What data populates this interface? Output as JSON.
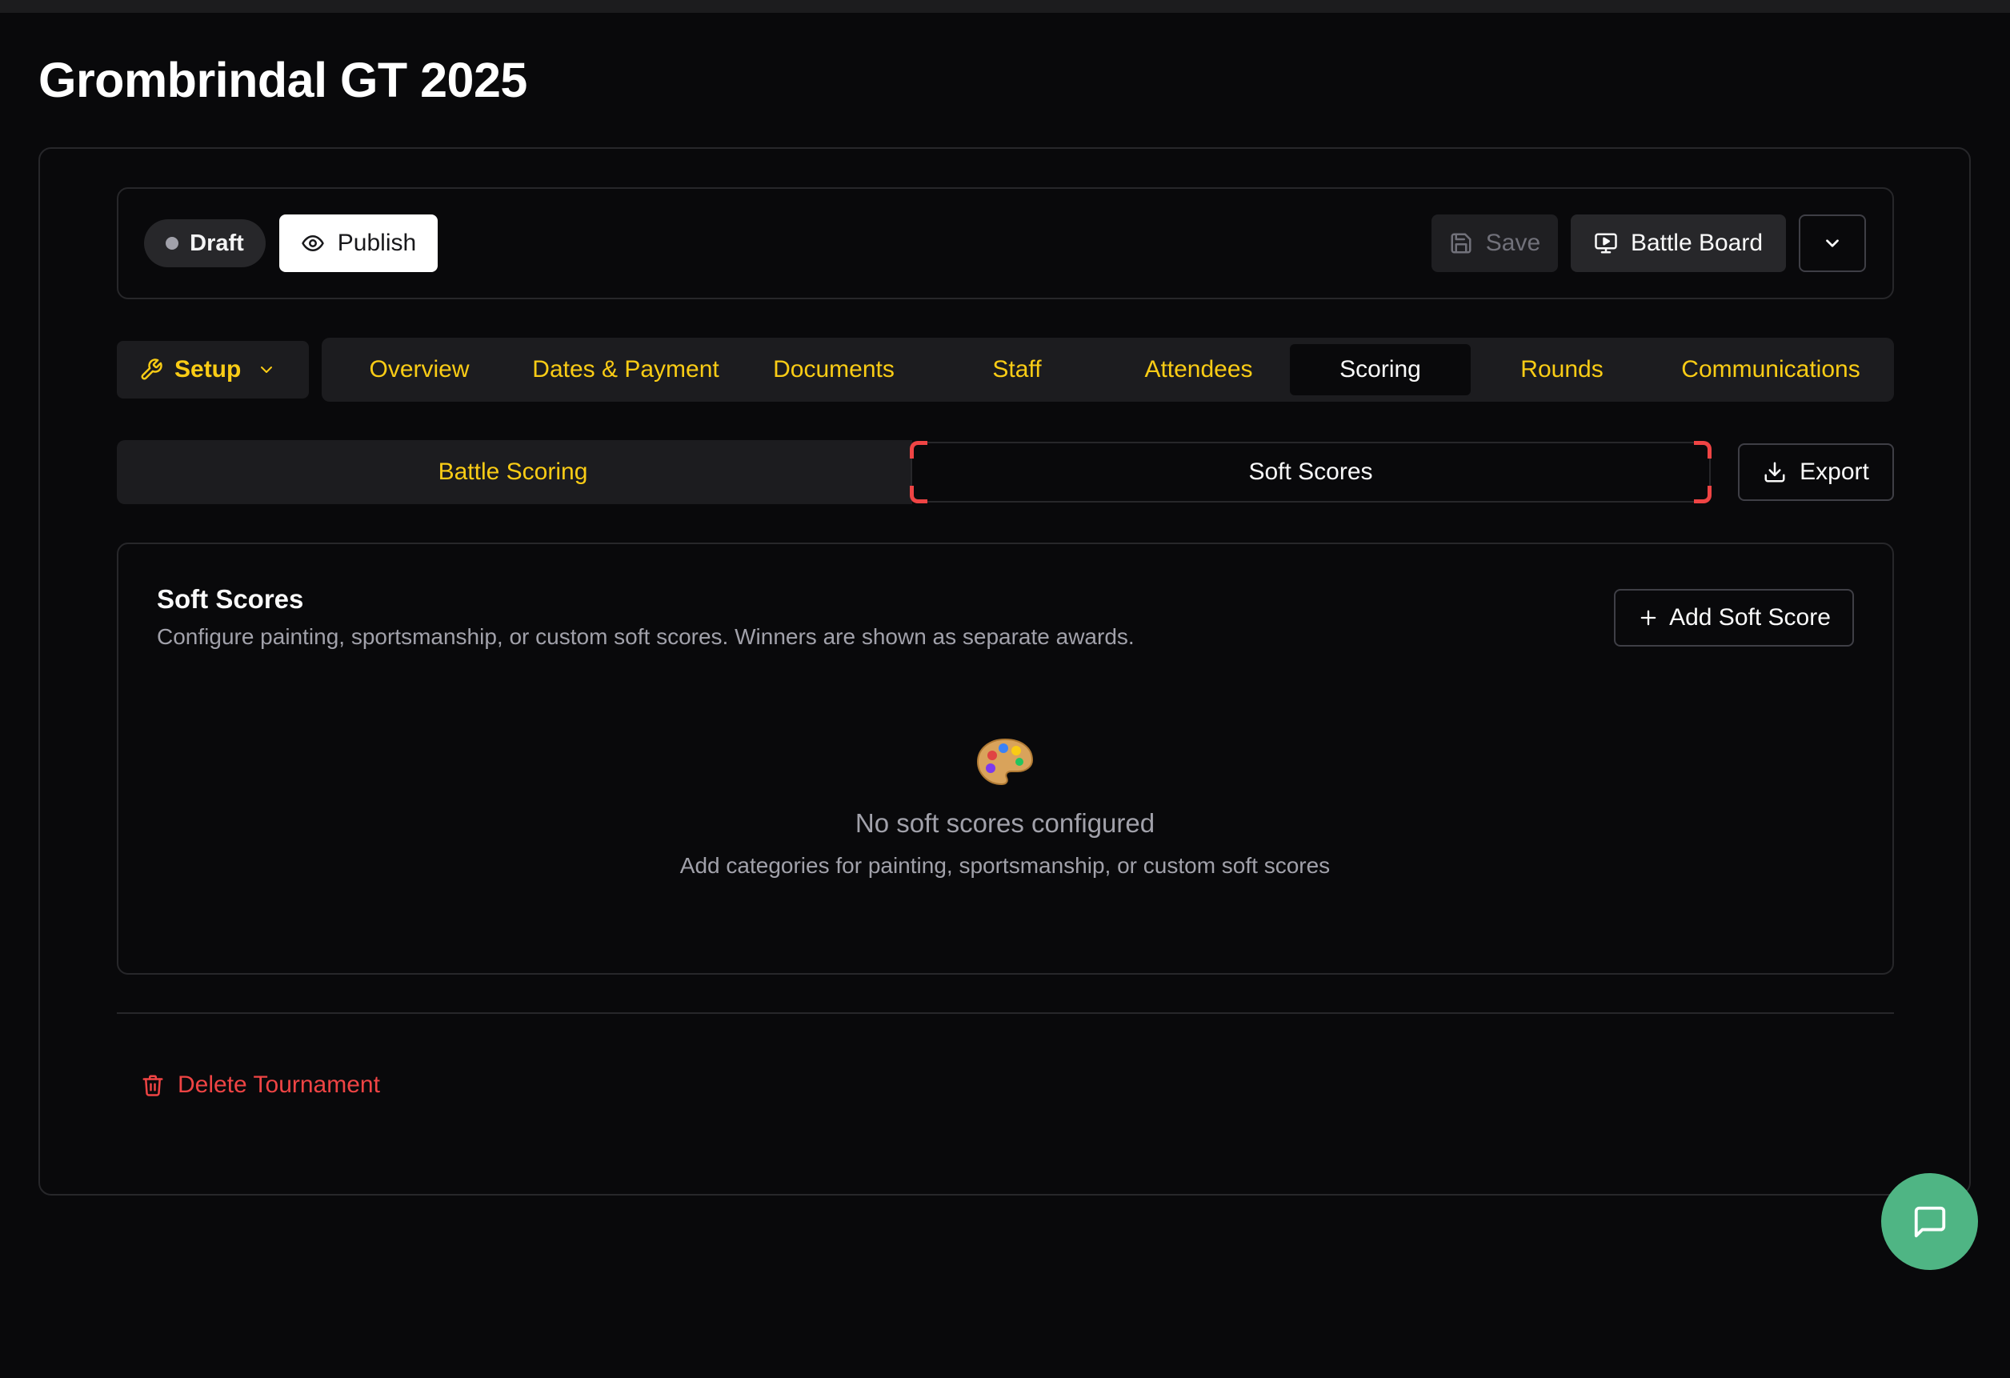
{
  "page": {
    "title": "Grombrindal GT 2025"
  },
  "status_bar": {
    "draft_label": "Draft",
    "publish_label": "Publish",
    "save_label": "Save",
    "battle_board_label": "Battle Board"
  },
  "nav": {
    "setup_label": "Setup",
    "tabs": [
      {
        "label": "Overview"
      },
      {
        "label": "Dates & Payment"
      },
      {
        "label": "Documents"
      },
      {
        "label": "Staff"
      },
      {
        "label": "Attendees"
      },
      {
        "label": "Scoring",
        "active": true
      },
      {
        "label": "Rounds"
      },
      {
        "label": "Communications"
      }
    ]
  },
  "subtabs": {
    "battle_scoring": "Battle Scoring",
    "soft_scores": "Soft Scores",
    "export_label": "Export"
  },
  "card": {
    "title": "Soft Scores",
    "description": "Configure painting, sportsmanship, or custom soft scores. Winners are shown as separate awards.",
    "add_button": "Add Soft Score",
    "empty_icon": "🎨",
    "empty_title": "No soft scores configured",
    "empty_description": "Add categories for painting, sportsmanship, or custom soft scores"
  },
  "footer": {
    "delete_label": "Delete Tournament"
  },
  "icons": {
    "draft": "status-dot-icon",
    "publish": "eye-icon",
    "save": "save-icon",
    "battle_board": "monitor-icon",
    "more": "chevron-down-icon",
    "setup": "wrench-icon",
    "export": "download-icon",
    "add": "plus-icon",
    "delete": "trash-icon",
    "chat": "chat-icon"
  },
  "colors": {
    "background": "#09090b",
    "accent_yellow": "#facc15",
    "danger": "#ef4444",
    "chat_button": "#4fb584",
    "highlight": "#ef4444"
  }
}
